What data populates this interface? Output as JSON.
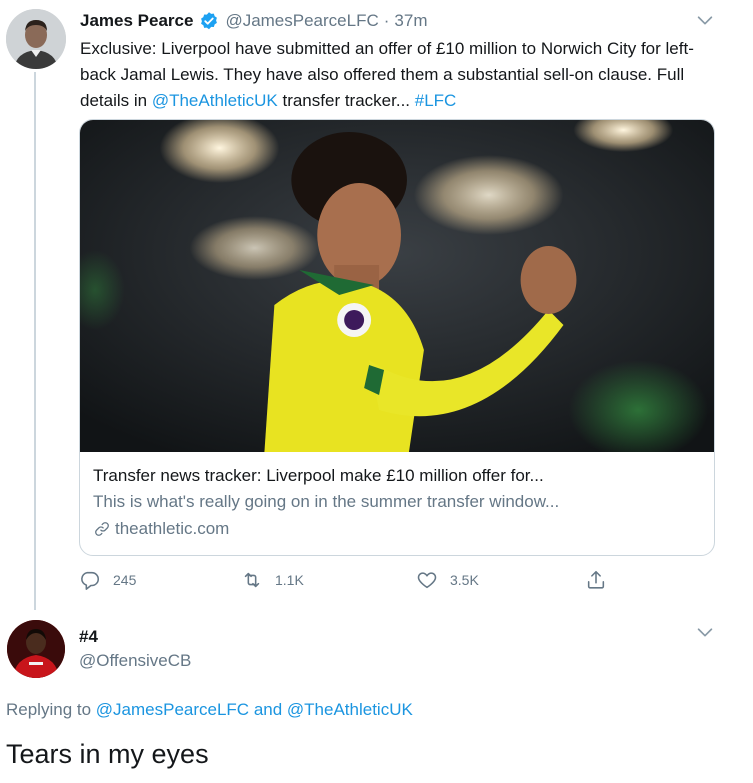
{
  "tweet": {
    "author_name": "James Pearce",
    "verified_icon": "verified-badge-icon",
    "handle": "@JamesPearceLFC",
    "separator": "·",
    "time": "37m",
    "text_plain_1": "Exclusive: Liverpool have submitted an offer of £10 million to Norwich City for left-back Jamal Lewis. They have also offered them a substantial sell-on clause. Full details in ",
    "mention": "@TheAthleticUK",
    "text_plain_2": " transfer tracker... ",
    "hashtag": "#LFC",
    "card": {
      "title": "Transfer news tracker: Liverpool make £10 million offer for...",
      "description": "This is what's really going on in the summer transfer window...",
      "domain": "theathletic.com"
    },
    "actions": {
      "reply_count": "245",
      "retweet_count": "1.1K",
      "like_count": "3.5K"
    }
  },
  "reply": {
    "author_name": "#4",
    "handle": "@OffensiveCB",
    "replying_prefix": "Replying to ",
    "replying_user_1": "@JamesPearceLFC",
    "replying_and": " and ",
    "replying_user_2": "@TheAthleticUK",
    "text": "Tears in my eyes"
  },
  "colors": {
    "link": "#1b95e0",
    "muted": "#657786",
    "text": "#14171a",
    "border": "#ccd6dd",
    "verified": "#1da1f2"
  }
}
